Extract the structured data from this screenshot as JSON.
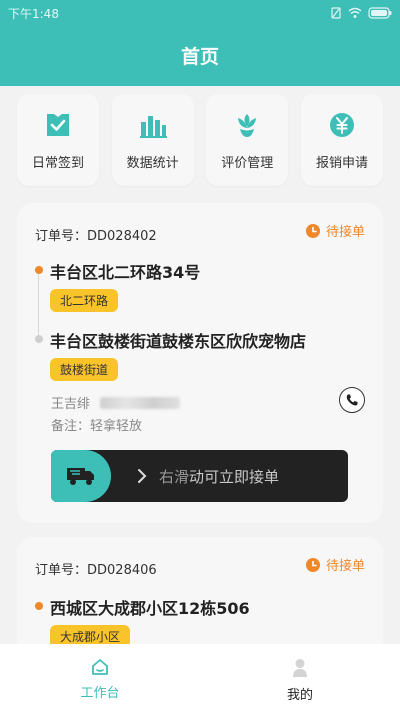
{
  "status_bar": {
    "time": "下午1:48"
  },
  "header": {
    "title": "首页"
  },
  "quick_actions": [
    {
      "label": "日常签到",
      "icon": "checkin-icon"
    },
    {
      "label": "数据统计",
      "icon": "bar-chart-icon"
    },
    {
      "label": "评价管理",
      "icon": "flower-icon"
    },
    {
      "label": "报销申请",
      "icon": "yuan-icon"
    }
  ],
  "orders": [
    {
      "order_no": "订单号：DD028402",
      "status": "待接单",
      "pickup_address": "丰台区北二环路34号",
      "pickup_tag": "北二环路",
      "dropoff_address": "丰台区鼓楼街道鼓楼东区欣欣宠物店",
      "dropoff_tag": "鼓楼街道",
      "contact_name": "王吉绯",
      "note": "备注：轻拿轻放",
      "slider_prefix": "右滑",
      "slider_emph": "动可立即接单"
    },
    {
      "order_no": "订单号：DD028406",
      "status": "待接单",
      "pickup_address": "西城区大成郡小区12栋506",
      "pickup_tag": "大成郡小区"
    }
  ],
  "tabbar": {
    "items": [
      {
        "label": "工作台",
        "active": true
      },
      {
        "label": "我的",
        "active": false
      }
    ]
  },
  "colors": {
    "primary": "#3dbfb8",
    "accent_orange": "#f0872a",
    "tag_yellow": "#f9c32a"
  }
}
